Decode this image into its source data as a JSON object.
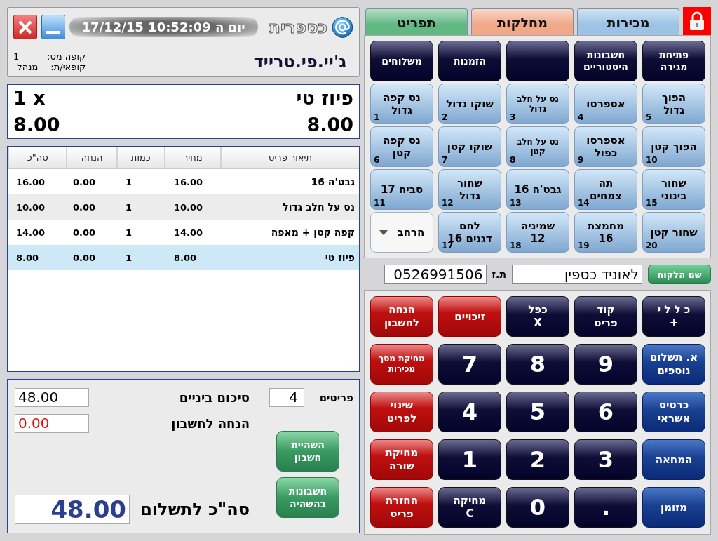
{
  "header": {
    "logo_text": "כספרית",
    "datetime": "יום ה 10:52:09 17/12/15",
    "store_name": "ג'יי.פי.טרייד",
    "info": [
      {
        "label": "קופה מס:",
        "value": "1"
      },
      {
        "label": "קופאי/ת:",
        "value": "מנהל"
      }
    ]
  },
  "display": {
    "item_name": "פיוז טי",
    "quantity": "1 x",
    "price": "8.00",
    "total": "8.00"
  },
  "table": {
    "columns": [
      "תיאור פריט",
      "מחיר",
      "כמות",
      "הנחה",
      "סה\"כ"
    ],
    "rows": [
      {
        "cells": [
          "גבט'ה 16",
          "16.00",
          "1",
          "0.00",
          "16.00"
        ],
        "selected": false
      },
      {
        "cells": [
          "נס על חלב גדול",
          "10.00",
          "1",
          "0.00",
          "10.00"
        ],
        "selected": false
      },
      {
        "cells": [
          "קפה קטן + מאפה",
          "14.00",
          "1",
          "0.00",
          "14.00"
        ],
        "selected": false
      },
      {
        "cells": [
          "פיוז טי",
          "8.00",
          "1",
          "0.00",
          "8.00"
        ],
        "selected": true
      }
    ]
  },
  "totals": {
    "items_label": "פריטים",
    "items_value": "4",
    "subtotal_label": "סיכום ביניים",
    "subtotal_value": "48.00",
    "discount_label": "הנחה לחשבון",
    "discount_value": "0.00",
    "buttons": [
      "השהיית\nחשבון",
      "חשבונות\nבהשהיה"
    ],
    "total_label": "סה\"כ לתשלום",
    "total_value": "48.00"
  },
  "tabs": [
    {
      "label": "מכירות",
      "color": "#9cc3e6"
    },
    {
      "label": "מחלקות",
      "color": "#f0a888"
    },
    {
      "label": "תפריט",
      "color": "#62b883"
    }
  ],
  "grid": [
    {
      "kind": "action",
      "label": "פתיחת\nמגירה"
    },
    {
      "kind": "action",
      "label": "חשבונות\nהיסטוריים"
    },
    {
      "kind": "action"
    },
    {
      "kind": "action",
      "label": "הזמנות"
    },
    {
      "kind": "action",
      "label": "משלוחים"
    },
    {
      "kind": "product",
      "label": "הפוך\nגדול",
      "number": "5"
    },
    {
      "kind": "product",
      "label": "אספרסו",
      "number": "4"
    },
    {
      "kind": "product",
      "label": "נס על חלב\nגדול",
      "number": "3",
      "small": true
    },
    {
      "kind": "product",
      "label": "שוקו גדול",
      "number": "2"
    },
    {
      "kind": "product",
      "label": "נס קפה\nגדול",
      "number": "1"
    },
    {
      "kind": "product",
      "label": "הפוך קטן",
      "number": "10"
    },
    {
      "kind": "product",
      "label": "אספרסו\nכפול",
      "number": "9"
    },
    {
      "kind": "product",
      "label": "נס על חלב\nקטן",
      "number": "8",
      "small": true
    },
    {
      "kind": "product",
      "label": "שוקו קטן",
      "number": "7"
    },
    {
      "kind": "product",
      "label": "נס קפה\nקטן",
      "number": "6"
    },
    {
      "kind": "product",
      "label": "שחור\nבינוני",
      "number": "15"
    },
    {
      "kind": "product",
      "label": "תה\nצמחים",
      "number": "14"
    },
    {
      "kind": "product",
      "label": "גבט'ה 16",
      "number": "13"
    },
    {
      "kind": "product",
      "label": "שחור\nגדול",
      "number": "12"
    },
    {
      "kind": "product",
      "label": "סביח 17",
      "number": "11"
    },
    {
      "kind": "product",
      "label": "שחור קטן",
      "number": "20"
    },
    {
      "kind": "product",
      "label": "מחמצת\n16",
      "number": "19"
    },
    {
      "kind": "product",
      "label": "שמיניה\n12",
      "number": "18"
    },
    {
      "kind": "product",
      "label": "לחם\nדגנים 16",
      "number": "17"
    },
    {
      "kind": "expand",
      "label": "הרחב"
    }
  ],
  "customer": {
    "button": "שם הלקוח",
    "name": "לאוניד כספין",
    "id_label": "ת.ז",
    "id_value": "0526991506"
  },
  "keypad": [
    {
      "kind": "dark",
      "label": "כ ל ל י\n+"
    },
    {
      "kind": "dark",
      "label": "קוד\nפריט"
    },
    {
      "kind": "dark",
      "label": "כפל\nX"
    },
    {
      "kind": "red",
      "label": "זיכויים"
    },
    {
      "kind": "red",
      "label": "הנחה\nלחשבון"
    },
    {
      "kind": "blue",
      "label": "א. תשלום\nנוספים"
    },
    {
      "kind": "digit",
      "label": "9"
    },
    {
      "kind": "digit",
      "label": "8"
    },
    {
      "kind": "digit",
      "label": "7"
    },
    {
      "kind": "red",
      "label": "מחיקת מסך\nמכירות",
      "small": true
    },
    {
      "kind": "blue",
      "label": "כרטיס\nאשראי"
    },
    {
      "kind": "digit",
      "label": "6"
    },
    {
      "kind": "digit",
      "label": "5"
    },
    {
      "kind": "digit",
      "label": "4"
    },
    {
      "kind": "red",
      "label": "שינוי\nלפריט"
    },
    {
      "kind": "blue",
      "label": "המחאה"
    },
    {
      "kind": "digit",
      "label": "3"
    },
    {
      "kind": "digit",
      "label": "2"
    },
    {
      "kind": "digit",
      "label": "1"
    },
    {
      "kind": "red",
      "label": "מחיקת\nשורה"
    },
    {
      "kind": "blue",
      "label": "מזומן"
    },
    {
      "kind": "digit",
      "label": "."
    },
    {
      "kind": "digit",
      "label": "0"
    },
    {
      "kind": "dark",
      "label": "מחיקה\nC"
    },
    {
      "kind": "red",
      "label": "החזרת\nפריט"
    }
  ]
}
